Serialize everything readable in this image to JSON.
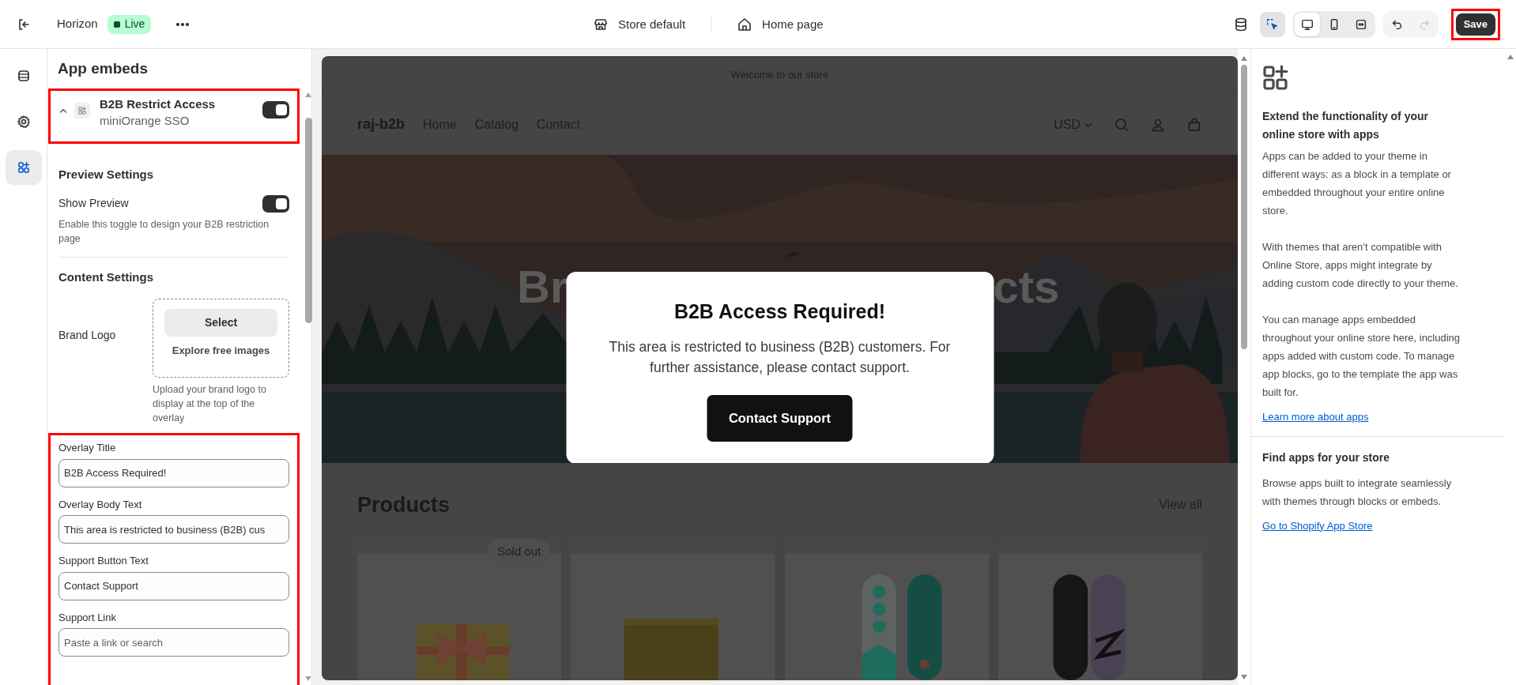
{
  "top_bar": {
    "theme_name": "Horizon",
    "status_badge": "Live",
    "store_selector": "Store default",
    "page_selector": "Home page",
    "inspector_selected": true,
    "view_modes": [
      {
        "kind": "desktop",
        "selected": true
      },
      {
        "kind": "mobile",
        "selected": false
      },
      {
        "kind": "fullwidth",
        "selected": false
      }
    ],
    "undo_disabled": false,
    "redo_disabled": true,
    "save_button": {
      "label": "Save",
      "highlighted": true
    }
  },
  "rail": [
    {
      "kind": "sections",
      "selected": false
    },
    {
      "kind": "settings",
      "selected": false
    },
    {
      "kind": "apps",
      "selected": true
    }
  ],
  "panel": {
    "title": "App embeds",
    "embed": {
      "name": "B2B Restrict Access",
      "provider": "miniOrange SSO",
      "expanded": true,
      "on": true,
      "highlighted": true
    },
    "preview_settings": {
      "heading": "Preview Settings",
      "label": "Show Preview",
      "on": true,
      "help": "Enable this toggle to design your B2B restriction page"
    },
    "content_settings": {
      "heading": "Content Settings",
      "logo_label": "Brand Logo",
      "select_button": "Select",
      "explore_link": "Explore free images",
      "help": "Upload your brand logo to display at the top of the overlay"
    },
    "fields_highlighted": true,
    "fields": [
      {
        "label": "Overlay Title",
        "value": "B2B Access Required!"
      },
      {
        "label": "Overlay Body Text",
        "value": "This area is restricted to business (B2B) cus"
      },
      {
        "label": "Support Button Text",
        "value": "Contact Support"
      },
      {
        "label": "Support Link",
        "placeholder": "Paste a link or search"
      }
    ]
  },
  "preview": {
    "announcement": "Welcome to our store",
    "logo": "raj-b2b",
    "nav": [
      "Home",
      "Catalog",
      "Contact"
    ],
    "currency": "USD",
    "hero_fragments": [
      "Br",
      "cts"
    ],
    "modal": {
      "title": "B2B Access Required!",
      "body": "This area is restricted to business (B2B) customers. For further assistance, please contact support.",
      "button": "Contact Support"
    },
    "products_heading": "Products",
    "view_all": "View all",
    "products": [
      {
        "kind": "picture",
        "badge": "Sold out"
      },
      {
        "kind": "picture"
      },
      {
        "kind": "picture"
      },
      {
        "kind": "picture"
      }
    ]
  },
  "info_panel": {
    "title": "Extend the functionality of your online store with apps",
    "paragraphs": [
      "Apps can be added to your theme in different ways: as a block in a template or embedded throughout your entire online store.",
      "With themes that aren’t compatible with Online Store, apps might integrate by adding custom code directly to your theme.",
      "You can manage apps embedded throughout your online store here, including apps added with custom code. To manage app blocks, go to the template the app was built for."
    ],
    "link": "Learn more about apps",
    "find_title": "Find apps for your store",
    "find_body": "Browse apps built to integrate seamlessly with themes through blocks or embeds.",
    "find_link": "Go to Shopify App Store"
  }
}
